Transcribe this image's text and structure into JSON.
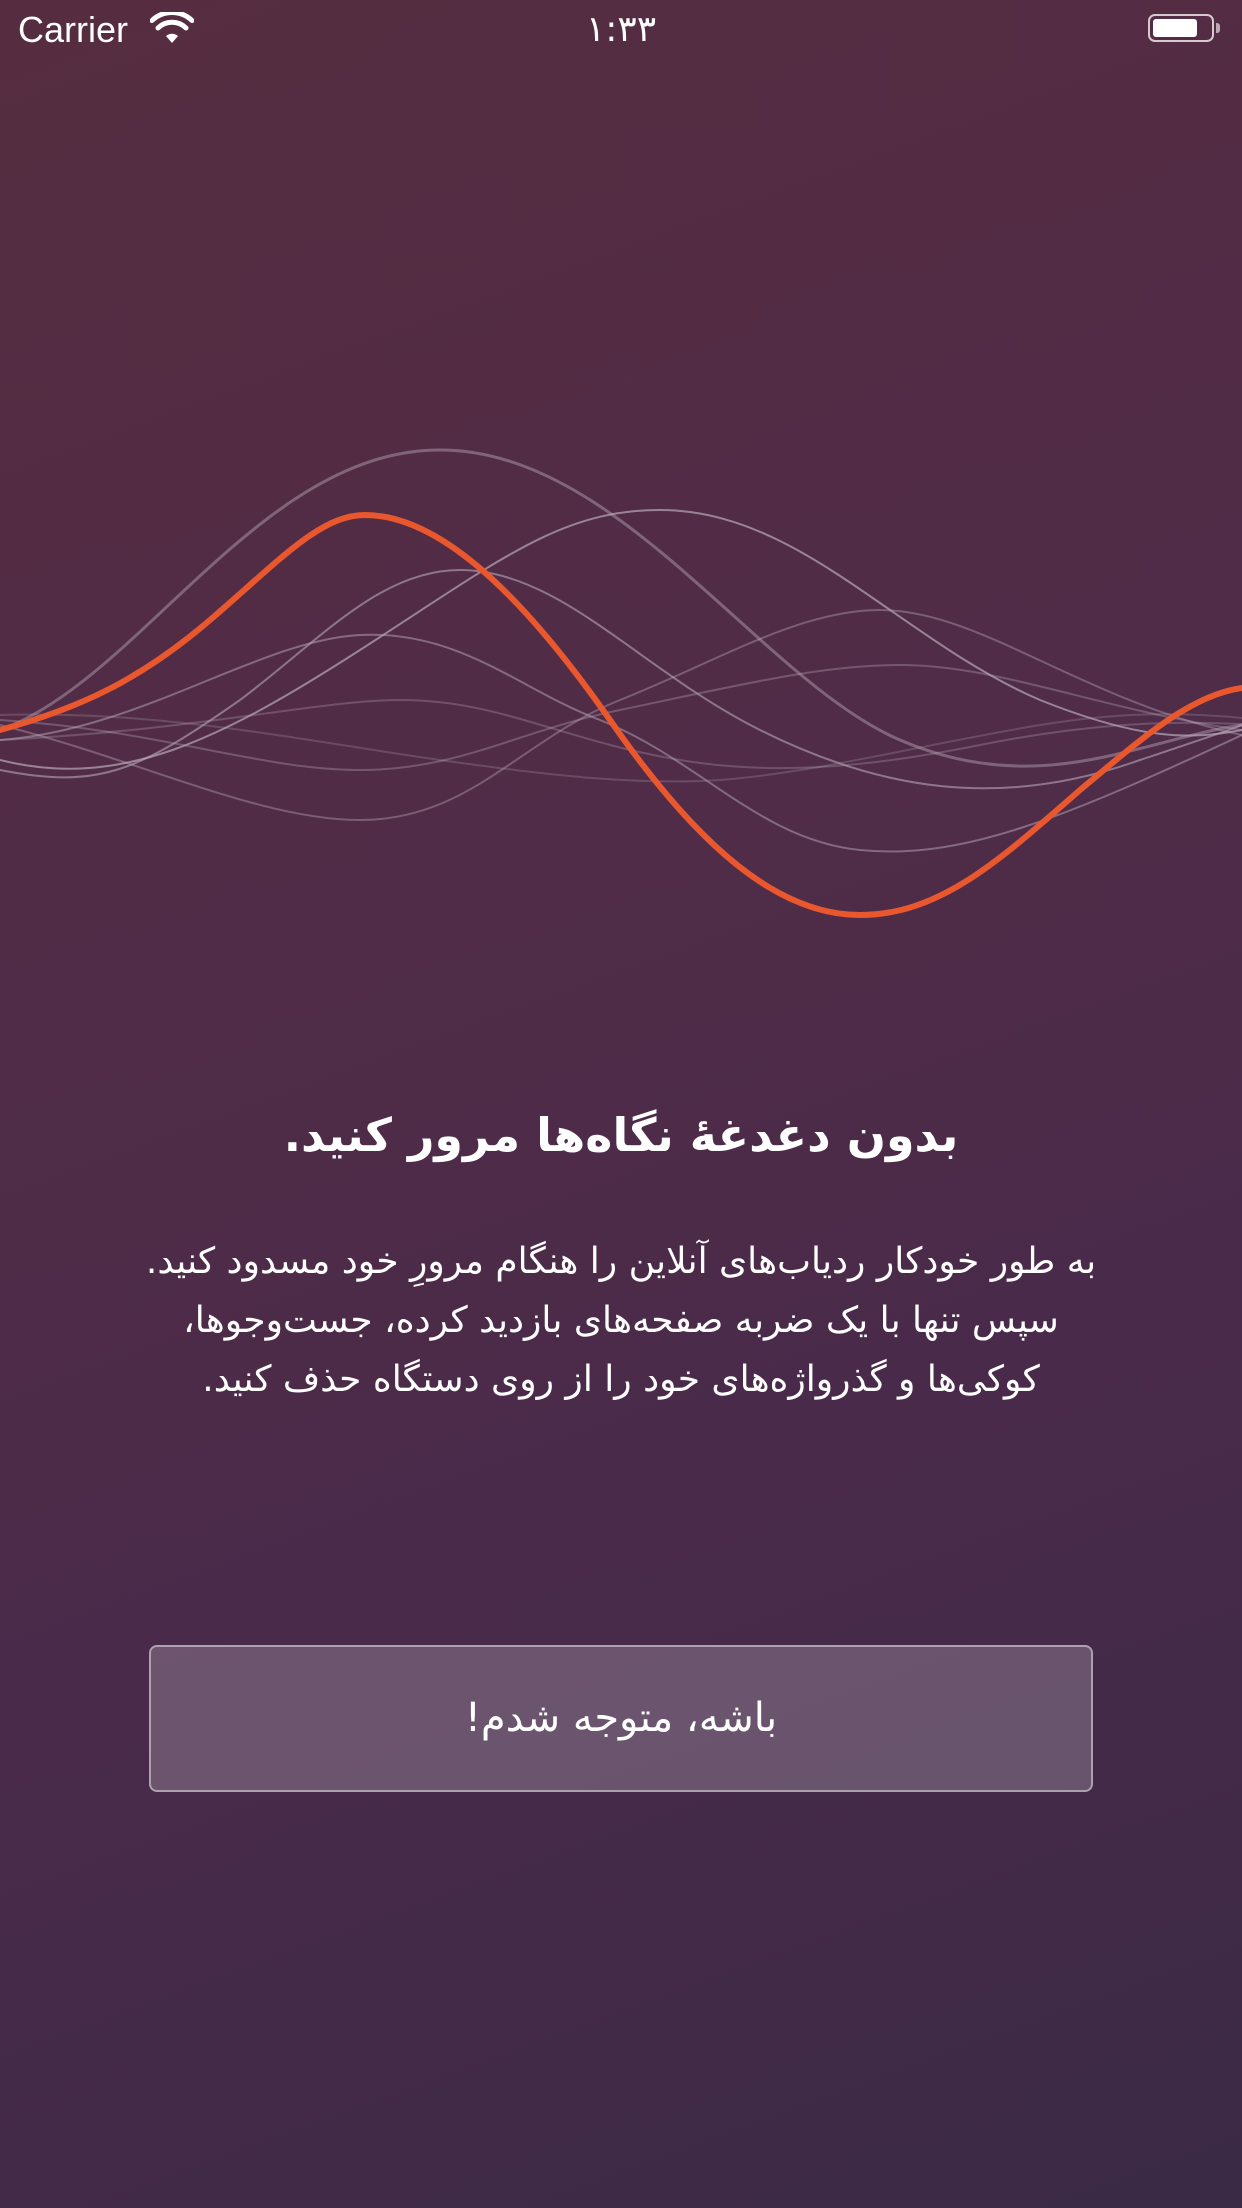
{
  "status_bar": {
    "carrier": "Carrier",
    "time": "۱:۳۳",
    "wifi_icon": "wifi-icon",
    "battery_icon": "battery-icon"
  },
  "illustration": {
    "icon": "sound-wave-illustration",
    "accent_color": "#e9572e"
  },
  "onboarding": {
    "title": "بدون دغدغهٔ نگاه‌ها مرور کنید.",
    "description": "به طور خودکار ردیاب‌های آنلاین را هنگام مرورِ خود مسدود کنید. سپس تنها با یک ضربه صفحه‌های بازدید کرده، جست‌وجوها، کوکی‌ها و گذرواژه‌های خود را از روی دستگاه حذف کنید.",
    "button_label": "باشه، متوجه شدم!"
  }
}
